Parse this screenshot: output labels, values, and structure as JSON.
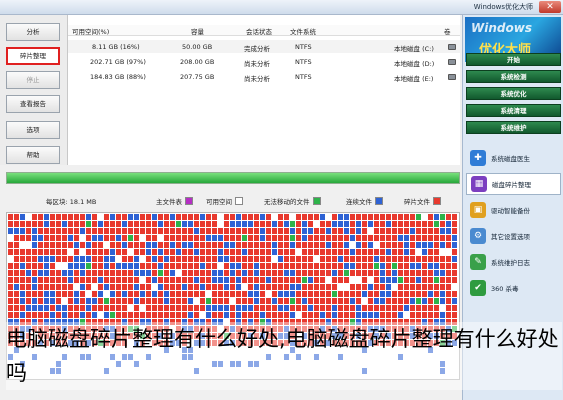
{
  "window": {
    "title": "Windows优化大师"
  },
  "left_buttons": [
    {
      "label": "分析",
      "state": "normal"
    },
    {
      "label": "碎片整理",
      "state": "active"
    },
    {
      "label": "停止",
      "state": "disabled"
    },
    {
      "label": "查看报告",
      "state": "normal"
    },
    {
      "label": "选项",
      "state": "normal"
    },
    {
      "label": "帮助",
      "state": "normal"
    }
  ],
  "volume_table": {
    "headers": [
      "卷",
      "文件系统",
      "会话状态",
      "容量",
      "可用空间(%)"
    ],
    "rows": [
      {
        "volume": "本地磁盘 (C:)",
        "fs": "NTFS",
        "status": "完成分析",
        "capacity": "50.00 GB",
        "free": "8.11 GB (16%)"
      },
      {
        "volume": "本地磁盘 (D:)",
        "fs": "NTFS",
        "status": "尚未分析",
        "capacity": "208.00 GB",
        "free": "202.71 GB (97%)"
      },
      {
        "volume": "本地磁盘 (E:)",
        "fs": "NTFS",
        "status": "尚未分析",
        "capacity": "207.75 GB",
        "free": "184.83 GB (88%)"
      }
    ]
  },
  "progress": {
    "fraction": 1.0
  },
  "legend": {
    "items": [
      {
        "label": "碎片文件",
        "color": "#e8392e"
      },
      {
        "label": "连续文件",
        "color": "#2e62d4"
      },
      {
        "label": "无法移动的文件",
        "color": "#2eb34a"
      },
      {
        "label": "可用空间",
        "color": "#ffffff"
      },
      {
        "label": "主文件表",
        "color": "#b52fc4"
      }
    ],
    "mft_label": "主文件表",
    "mft_size": "每区块: 18.1 MB"
  },
  "right_panel": {
    "logo_line1": "Windows",
    "logo_line2": "优化大师",
    "nav": [
      "开始",
      "系统检测",
      "系统优化",
      "系统清理",
      "系统维护"
    ],
    "tools": [
      {
        "label": "系统磁盘医生",
        "icon": "disk-doctor-icon",
        "color": "#2f7cd6"
      },
      {
        "label": "磁盘碎片整理",
        "icon": "defrag-icon",
        "color": "#7c3fc0"
      },
      {
        "label": "驱动智能备份",
        "icon": "driver-backup-icon",
        "color": "#e0a020"
      },
      {
        "label": "其它设置选项",
        "icon": "settings-icon",
        "color": "#4a8ad0"
      },
      {
        "label": "系统维护日志",
        "icon": "log-icon",
        "color": "#3aa04a"
      },
      {
        "label": "360 杀毒",
        "icon": "antivirus-icon",
        "color": "#2f9b3f"
      }
    ]
  },
  "caption": "电脑磁盘碎片整理有什么好处,电脑磁盘碎片整理有什么好处吗"
}
